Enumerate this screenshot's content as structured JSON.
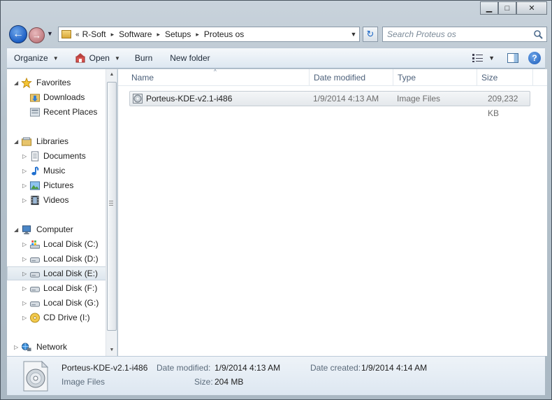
{
  "window": {
    "caption_buttons": [
      {
        "name": "minimize",
        "glyph": "▁"
      },
      {
        "name": "maximize",
        "glyph": "□"
      },
      {
        "name": "close",
        "glyph": "✕"
      }
    ]
  },
  "nav": {
    "back_glyph": "←",
    "forward_glyph": "→",
    "history_glyph": "▼",
    "breadcrumbs_prefix": "«",
    "breadcrumbs": [
      "R-Soft",
      "Software",
      "Setups",
      "Proteus os"
    ],
    "crumb_sep": "▸",
    "refresh_glyph": "↻",
    "search_placeholder": "Search Proteus os"
  },
  "toolbar": {
    "organize": "Organize",
    "open": "Open",
    "burn": "Burn",
    "new_folder": "New folder",
    "dropdown_glyph": "▼",
    "help_glyph": "?"
  },
  "sidebar": {
    "favorites": "Favorites",
    "downloads": "Downloads",
    "recent_places": "Recent Places",
    "libraries": "Libraries",
    "documents": "Documents",
    "music": "Music",
    "pictures": "Pictures",
    "videos": "Videos",
    "computer": "Computer",
    "disk_c": "Local Disk (C:)",
    "disk_d": "Local Disk (D:)",
    "disk_e": "Local Disk (E:)",
    "disk_f": "Local Disk (F:)",
    "disk_g": "Local Disk (G:)",
    "cd_drive": "CD Drive (I:)",
    "network": "Network",
    "expanded_glyph": "◢",
    "collapsed_glyph": "▷"
  },
  "columns": {
    "name": "Name",
    "date_modified": "Date modified",
    "type": "Type",
    "size": "Size",
    "sort_glyph": "^"
  },
  "files": [
    {
      "name": "Porteus-KDE-v2.1-i486",
      "date_modified": "1/9/2014 4:13 AM",
      "type": "Image Files",
      "size": "209,232 KB"
    }
  ],
  "details": {
    "name": "Porteus-KDE-v2.1-i486",
    "type": "Image Files",
    "date_modified_label": "Date modified:",
    "date_modified": "1/9/2014 4:13 AM",
    "date_created_label": "Date created:",
    "date_created": "1/9/2014 4:14 AM",
    "size_label": "Size:",
    "size": "204 MB"
  },
  "colors": {
    "accent": "#1d5fc4",
    "selection": "#dde6ee"
  }
}
